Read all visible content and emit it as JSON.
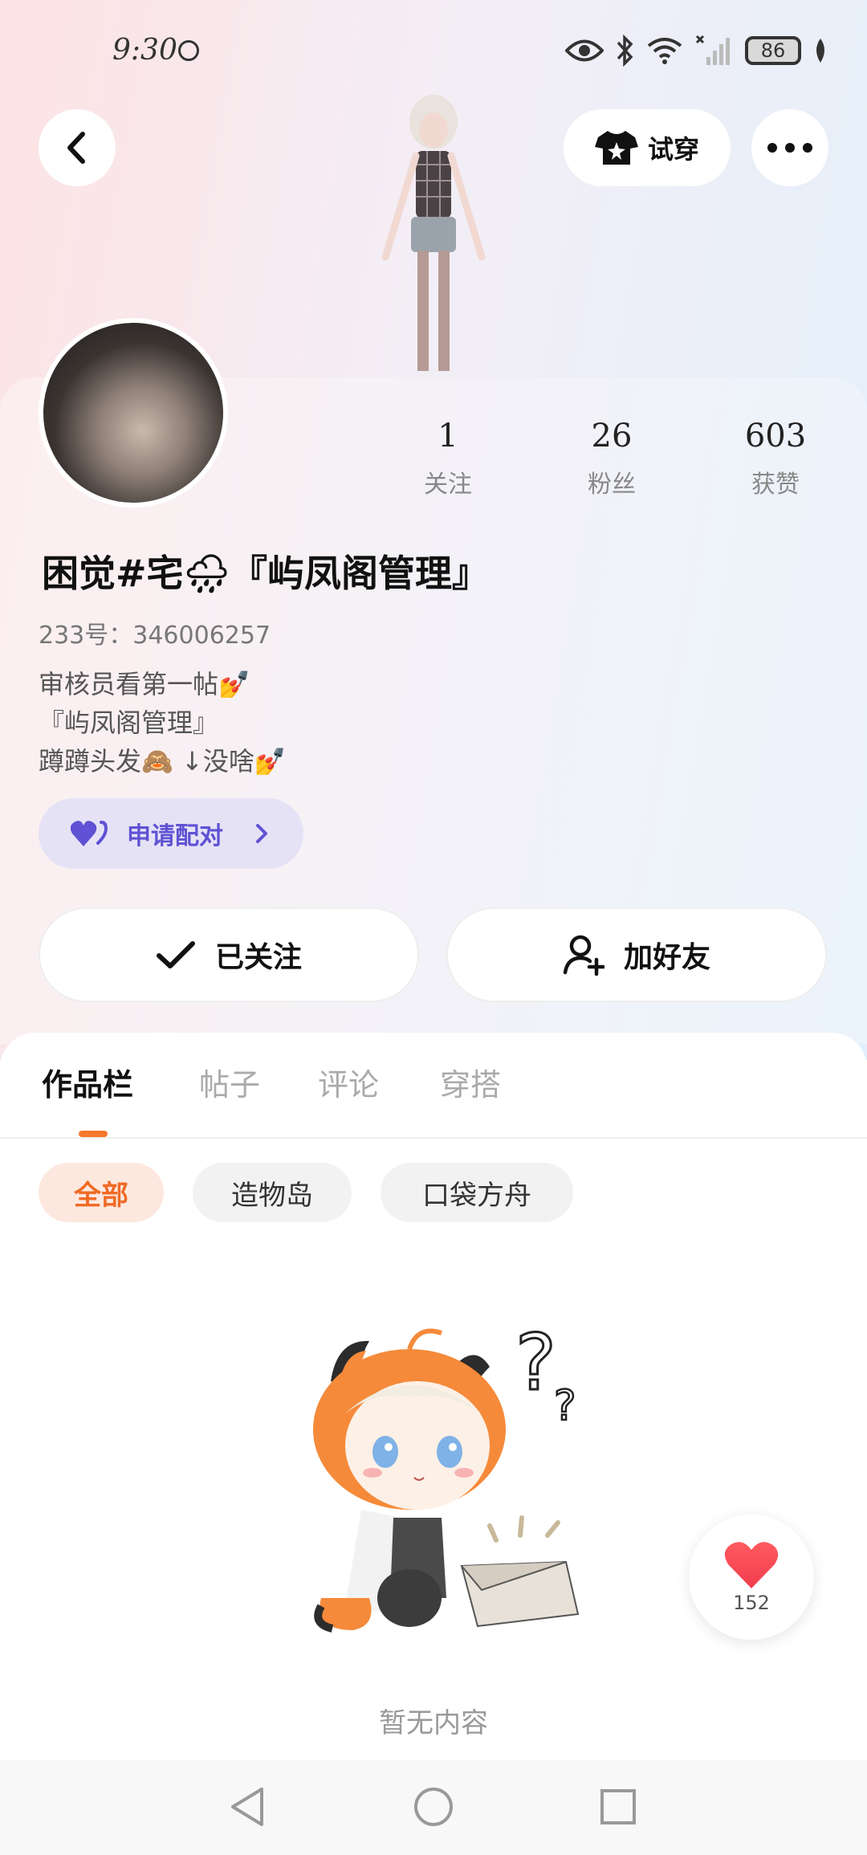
{
  "status_bar": {
    "time": "9:30",
    "battery": "86"
  },
  "top_bar": {
    "try_on_label": "试穿"
  },
  "profile": {
    "nickname": "困觉#宅🌧『屿凤阁管理』",
    "uid": "233号：346006257",
    "bio": [
      "审核员看第一帖💅",
      "『屿凤阁管理』",
      "蹲蹲头发🙈 ↓没啥💅"
    ],
    "stats": [
      {
        "value": "1",
        "label": "关注"
      },
      {
        "value": "26",
        "label": "粉丝"
      },
      {
        "value": "603",
        "label": "获赞"
      }
    ],
    "pair_button_label": "申请配对",
    "follow_button_label": "已关注",
    "add_friend_button_label": "加好友"
  },
  "tabs": [
    {
      "label": "作品栏",
      "active": true
    },
    {
      "label": "帖子",
      "active": false
    },
    {
      "label": "评论",
      "active": false
    },
    {
      "label": "穿搭",
      "active": false
    }
  ],
  "filters": [
    {
      "label": "全部",
      "active": true
    },
    {
      "label": "造物岛",
      "active": false
    },
    {
      "label": "口袋方舟",
      "active": false
    }
  ],
  "empty_state": {
    "text": "暂无内容"
  },
  "like_fab": {
    "count": "152"
  },
  "colors": {
    "accent_orange": "#f7792d",
    "pair_purple": "#5f52d4",
    "like_red": "#f23d4f"
  }
}
